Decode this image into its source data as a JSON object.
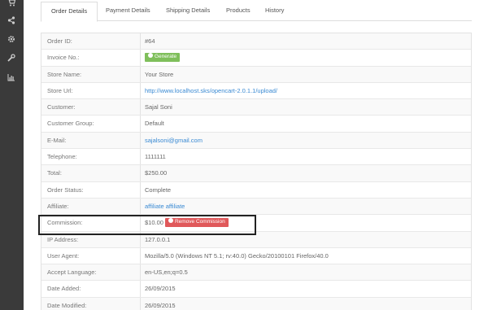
{
  "sidebar": {
    "icons": [
      "cart-icon",
      "share-icon",
      "gear-icon",
      "wrench-icon",
      "bar-chart-icon"
    ]
  },
  "tabs": [
    {
      "label": "Order Details",
      "active": true
    },
    {
      "label": "Payment Details",
      "active": false
    },
    {
      "label": "Shipping Details",
      "active": false
    },
    {
      "label": "Products",
      "active": false
    },
    {
      "label": "History",
      "active": false
    }
  ],
  "order": {
    "rows": [
      {
        "label": "Order ID:",
        "value": "#64"
      },
      {
        "label": "Invoice No.:",
        "button": "Generate"
      },
      {
        "label": "Store Name:",
        "value": "Your Store"
      },
      {
        "label": "Store Url:",
        "value": "http://www.localhost.sks/opencart-2.0.1.1/upload/"
      },
      {
        "label": "Customer:",
        "value": "Sajal Soni"
      },
      {
        "label": "Customer Group:",
        "value": "Default"
      },
      {
        "label": "E-Mail:",
        "value": "sajalsoni@gmail.com"
      },
      {
        "label": "Telephone:",
        "value": "1111111"
      },
      {
        "label": "Total:",
        "value": "$250.00"
      },
      {
        "label": "Order Status:",
        "value": "Complete"
      },
      {
        "label": "Affiliate:",
        "value": "affiliate affiliate"
      },
      {
        "label": "Commission:",
        "value": "$10.00",
        "button": "Remove Commission"
      },
      {
        "label": "IP Address:",
        "value": "127.0.0.1"
      },
      {
        "label": "User Agent:",
        "value": "Mozilla/5.0 (Windows NT 5.1; rv:40.0) Gecko/20100101 Firefox/40.0"
      },
      {
        "label": "Accept Language:",
        "value": "en-US,en;q=0.5"
      },
      {
        "label": "Date Added:",
        "value": "26/09/2015"
      },
      {
        "label": "Date Modified:",
        "value": "26/09/2015"
      }
    ]
  },
  "colors": {
    "sidebar": "#3a3a3a",
    "link": "#3a8ad3",
    "generate_button": "#7fbf5b",
    "remove_button": "#e0585a"
  }
}
